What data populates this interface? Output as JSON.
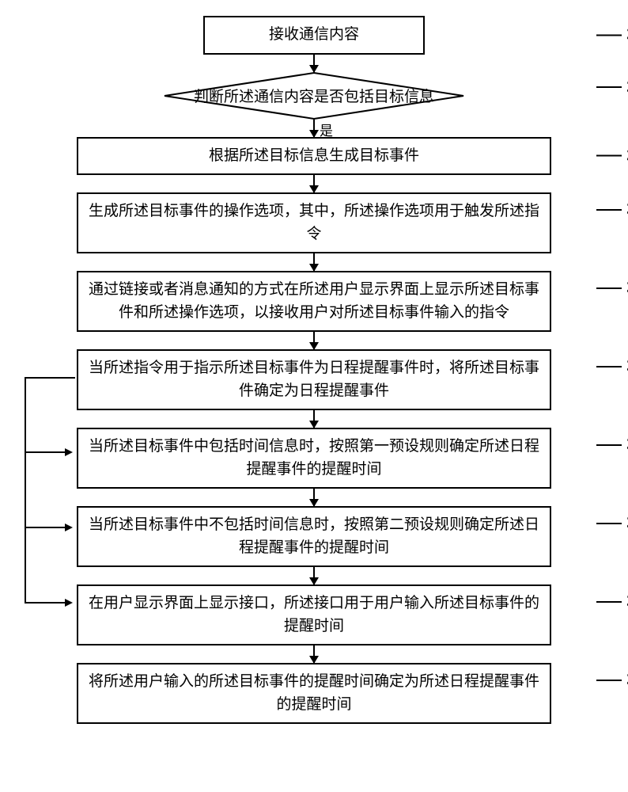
{
  "chart_data": {
    "type": "flowchart",
    "title": "",
    "steps": [
      {
        "id": "301",
        "shape": "process",
        "text": "接收通信内容"
      },
      {
        "id": "302",
        "shape": "decision",
        "text": "判断所述通信内容是否包括目标信息"
      },
      {
        "id": "303",
        "shape": "process",
        "text": "根据所述目标信息生成目标事件"
      },
      {
        "id": "304",
        "shape": "process",
        "text": "生成所述目标事件的操作选项，其中，所述操作选项用于触发所述指令"
      },
      {
        "id": "305",
        "shape": "process",
        "text": "通过链接或者消息通知的方式在所述用户显示界面上显示所述目标事件和所述操作选项，以接收用户对所述目标事件输入的指令"
      },
      {
        "id": "306",
        "shape": "process",
        "text": "当所述指令用于指示所述目标事件为日程提醒事件时，将所述目标事件确定为日程提醒事件"
      },
      {
        "id": "307",
        "shape": "process",
        "text": "当所述目标事件中包括时间信息时，按照第一预设规则确定所述日程提醒事件的提醒时间"
      },
      {
        "id": "308",
        "shape": "process",
        "text": "当所述目标事件中不包括时间信息时，按照第二预设规则确定所述日程提醒事件的提醒时间"
      },
      {
        "id": "309",
        "shape": "process",
        "text": "在用户显示界面上显示接口，所述接口用于用户输入所述目标事件的提醒时间"
      },
      {
        "id": "310",
        "shape": "process",
        "text": "将所述用户输入的所述目标事件的提醒时间确定为所述日程提醒事件的提醒时间"
      }
    ],
    "edges": [
      {
        "from": "301",
        "to": "302",
        "label": ""
      },
      {
        "from": "302",
        "to": "303",
        "label": "是"
      },
      {
        "from": "303",
        "to": "304",
        "label": ""
      },
      {
        "from": "304",
        "to": "305",
        "label": ""
      },
      {
        "from": "305",
        "to": "306",
        "label": ""
      },
      {
        "from": "306",
        "to": "307",
        "label": ""
      },
      {
        "from": "306",
        "to": "308",
        "label": ""
      },
      {
        "from": "306",
        "to": "309",
        "label": ""
      },
      {
        "from": "307",
        "to": "308",
        "label": ""
      },
      {
        "from": "308",
        "to": "309",
        "label": ""
      },
      {
        "from": "309",
        "to": "310",
        "label": ""
      }
    ]
  },
  "decision_yes": "是"
}
